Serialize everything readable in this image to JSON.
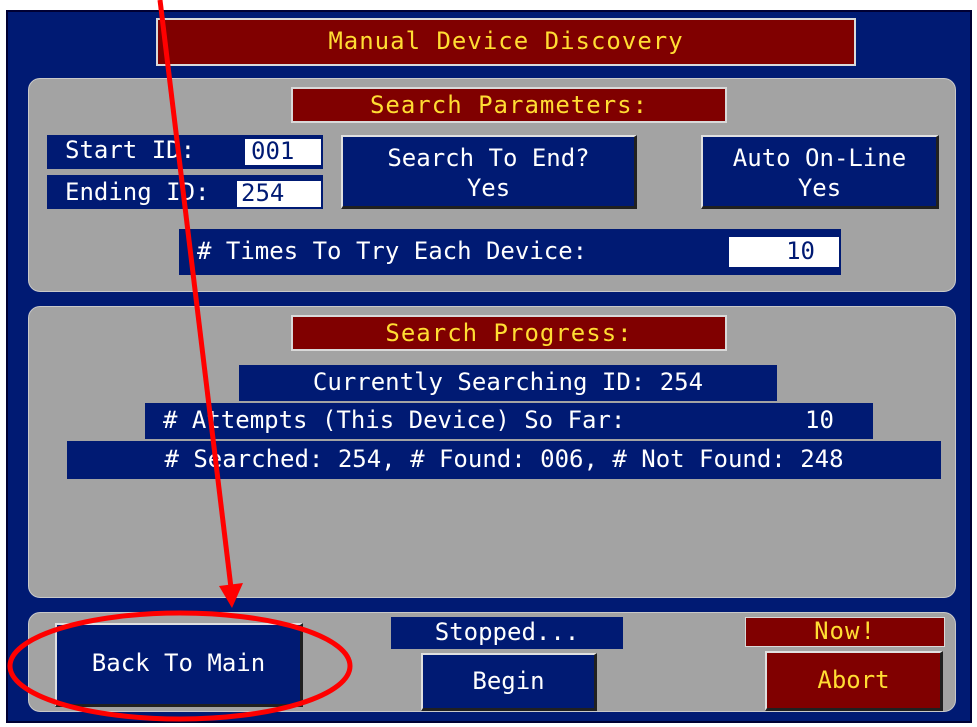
{
  "window": {
    "title": "Manual Device Discovery"
  },
  "search_parameters": {
    "heading": "Search Parameters:",
    "start_id_label": "Start ID:",
    "start_id_value": "001",
    "ending_id_label": "Ending ID:",
    "ending_id_value": "254",
    "search_to_end_label": "Search To End?",
    "search_to_end_value": "Yes",
    "auto_online_label": "Auto On-Line",
    "auto_online_value": "Yes",
    "times_to_try_label": "# Times To Try Each Device:",
    "times_to_try_value": "10"
  },
  "search_progress": {
    "heading": "Search Progress:",
    "currently_searching": "Currently Searching ID: 254",
    "attempts_label": "# Attempts (This Device) So Far:",
    "attempts_value": "10",
    "summary": "# Searched: 254, # Found: 006, # Not Found: 248"
  },
  "controls": {
    "back_button": "Back To Main",
    "status": "Stopped...",
    "begin_button": "Begin",
    "now_label": "Now!",
    "abort_button": "Abort"
  },
  "colors": {
    "screen_blue": "#001a73",
    "panel_gray": "#a3a3a3",
    "title_red": "#800000",
    "title_text_yellow": "#ffdd33",
    "annotation_red": "#ff0000"
  }
}
